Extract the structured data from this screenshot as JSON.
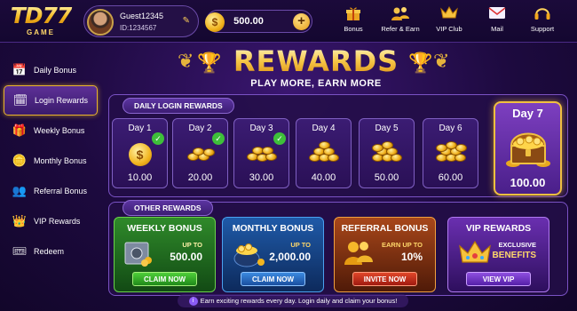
{
  "logo": {
    "text": "TD77",
    "sub": "GAME"
  },
  "profile": {
    "name": "Guest12345",
    "id": "ID:1234567"
  },
  "balance": {
    "value": "500.00",
    "coin_symbol": "$"
  },
  "top_nav": [
    {
      "label": "Bonus",
      "icon": "gift-icon"
    },
    {
      "label": "Refer & Earn",
      "icon": "refer-icon"
    },
    {
      "label": "VIP Club",
      "icon": "crown-icon"
    },
    {
      "label": "Mail",
      "icon": "mail-icon"
    },
    {
      "label": "Support",
      "icon": "headset-icon"
    }
  ],
  "sidebar": {
    "items": [
      {
        "label": "Daily Bonus",
        "icon": "calendar-icon",
        "active": false
      },
      {
        "label": "Login Rewards",
        "icon": "calendar-check-icon",
        "active": true
      },
      {
        "label": "Weekly Bonus",
        "icon": "gift-icon",
        "active": false
      },
      {
        "label": "Monthly Bonus",
        "icon": "coins-icon",
        "active": false
      },
      {
        "label": "Referral Bonus",
        "icon": "users-icon",
        "active": false
      },
      {
        "label": "VIP Rewards",
        "icon": "crown-icon",
        "active": false
      },
      {
        "label": "Redeem",
        "icon": "ticket-icon",
        "active": false
      }
    ]
  },
  "header": {
    "title": "REWARDS",
    "subtitle": "PLAY MORE, EARN MORE"
  },
  "daily_login": {
    "section_label": "DAILY LOGIN REWARDS",
    "days": [
      {
        "label": "Day 1",
        "value": "10.00",
        "claimed": true
      },
      {
        "label": "Day 2",
        "value": "20.00",
        "claimed": true
      },
      {
        "label": "Day 3",
        "value": "30.00",
        "claimed": true
      },
      {
        "label": "Day 4",
        "value": "40.00",
        "claimed": false
      },
      {
        "label": "Day 5",
        "value": "50.00",
        "claimed": false
      },
      {
        "label": "Day 6",
        "value": "60.00",
        "claimed": false
      }
    ],
    "day7": {
      "label": "Day 7",
      "value": "100.00"
    }
  },
  "other_rewards": {
    "section_label": "OTHER REWARDS",
    "cards": [
      {
        "title": "WEEKLY BONUS",
        "line1": "UP TO",
        "value": "500.00",
        "button": "CLAIM NOW",
        "icon": "safe-icon"
      },
      {
        "title": "MONTHLY BONUS",
        "line1": "UP TO",
        "value": "2,000.00",
        "button": "CLAIM NOW",
        "icon": "coin-pot-icon"
      },
      {
        "title": "REFERRAL BONUS",
        "line1": "EARN UP TO",
        "value": "10%",
        "button": "INVITE NOW",
        "icon": "users-icon"
      },
      {
        "title": "VIP REWARDS",
        "line1": "EXCLUSIVE",
        "value": "BENEFITS",
        "button": "VIEW VIP",
        "icon": "crown-icon"
      }
    ]
  },
  "footer": {
    "note": "Earn exciting rewards every day. Login daily and claim your bonus!"
  },
  "colors": {
    "gold": "#f2b51f",
    "purple_bg": "#1d0a3f",
    "active_border": "#e9b52e",
    "check_green": "#3ebf3a"
  }
}
